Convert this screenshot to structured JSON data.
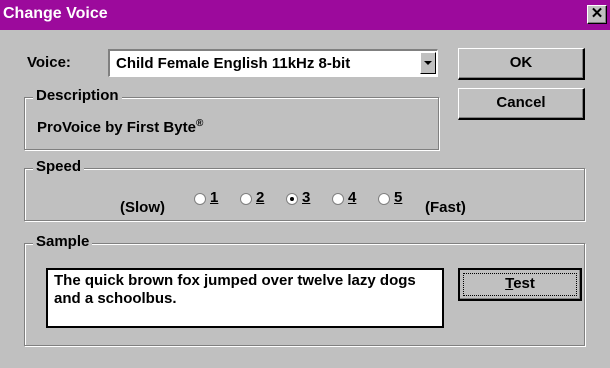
{
  "window": {
    "title": "Change Voice",
    "close_glyph": "✕"
  },
  "voice": {
    "label": "Voice:",
    "selected": "Child Female English 11kHz 8-bit"
  },
  "buttons": {
    "ok": "OK",
    "cancel": "Cancel",
    "test_T": "T",
    "test_rest": "est"
  },
  "description": {
    "title": "Description",
    "text": "ProVoice by First Byte",
    "mark": "®"
  },
  "speed": {
    "title": "Speed",
    "slow_label": "(Slow)",
    "fast_label": "(Fast)",
    "options": [
      "1",
      "2",
      "3",
      "4",
      "5"
    ],
    "selected": "3"
  },
  "sample": {
    "title": "Sample",
    "text": "The quick brown fox jumped over twelve lazy dogs and a schoolbus."
  }
}
